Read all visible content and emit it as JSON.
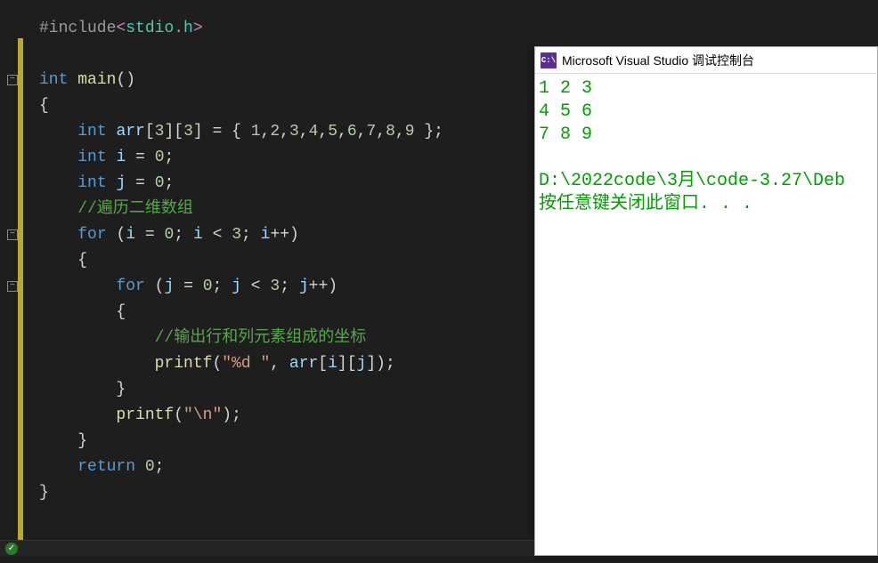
{
  "editor": {
    "lines": [
      {
        "html": "<span class='pp'>#include</span><span class='hd'>&lt;</span><span class='hn'>stdio.h</span><span class='hd'>&gt;</span>",
        "indent": 1
      },
      {
        "html": "",
        "indent": 0
      },
      {
        "html": "<span class='kw'>int</span> <span class='fn'>main</span><span class='pu'>()</span>",
        "indent": 0,
        "fold": true
      },
      {
        "html": "<span class='pu'>{</span>",
        "indent": 0
      },
      {
        "html": "    <span class='kw'>int</span> <span class='id'>arr</span><span class='pu'>[</span><span class='nm'>3</span><span class='pu'>][</span><span class='nm'>3</span><span class='pu'>] = { </span><span class='nm'>1</span><span class='pu'>,</span><span class='nm'>2</span><span class='pu'>,</span><span class='nm'>3</span><span class='pu'>,</span><span class='nm'>4</span><span class='pu'>,</span><span class='nm'>5</span><span class='pu'>,</span><span class='nm'>6</span><span class='pu'>,</span><span class='nm'>7</span><span class='pu'>,</span><span class='nm'>8</span><span class='pu'>,</span><span class='nm'>9</span><span class='pu'> };</span>",
        "indent": 0
      },
      {
        "html": "    <span class='kw'>int</span> <span class='id'>i</span> <span class='pu'>=</span> <span class='nm'>0</span><span class='pu'>;</span>",
        "indent": 0
      },
      {
        "html": "    <span class='kw'>int</span> <span class='id'>j</span> <span class='pu'>=</span> <span class='nm'>0</span><span class='pu'>;</span>",
        "indent": 0
      },
      {
        "html": "    <span class='cm'>//遍历二维数组</span>",
        "indent": 0
      },
      {
        "html": "    <span class='kw'>for</span> <span class='pu'>(</span><span class='id'>i</span> <span class='pu'>=</span> <span class='nm'>0</span><span class='pu'>;</span> <span class='id'>i</span> <span class='pu'>&lt;</span> <span class='nm'>3</span><span class='pu'>;</span> <span class='id'>i</span><span class='pu'>++)</span>",
        "indent": 0,
        "fold": true
      },
      {
        "html": "    <span class='pu'>{</span>",
        "indent": 0
      },
      {
        "html": "        <span class='kw'>for</span> <span class='pu'>(</span><span class='id'>j</span> <span class='pu'>=</span> <span class='nm'>0</span><span class='pu'>;</span> <span class='id'>j</span> <span class='pu'>&lt;</span> <span class='nm'>3</span><span class='pu'>;</span> <span class='id'>j</span><span class='pu'>++)</span>",
        "indent": 0,
        "fold": true
      },
      {
        "html": "        <span class='pu'>{</span>",
        "indent": 0
      },
      {
        "html": "            <span class='cm'>//输出行和列元素组成的坐标</span>",
        "indent": 0
      },
      {
        "html": "            <span class='fn'>printf</span><span class='pu'>(</span><span class='st'>\"%d \"</span><span class='pu'>,</span> <span class='id'>arr</span><span class='pu'>[</span><span class='id'>i</span><span class='pu'>][</span><span class='id'>j</span><span class='pu'>]);</span>",
        "indent": 0
      },
      {
        "html": "        <span class='pu'>}</span>",
        "indent": 0
      },
      {
        "html": "        <span class='fn'>printf</span><span class='pu'>(</span><span class='st'>\"\\n\"</span><span class='pu'>);</span>",
        "indent": 0,
        "highlight": true
      },
      {
        "html": "    <span class='pu'>}</span>",
        "indent": 0
      },
      {
        "html": "    <span class='kw'>return</span> <span class='nm'>0</span><span class='pu'>;</span>",
        "indent": 0
      },
      {
        "html": "<span class='pu'>}</span>",
        "indent": 0
      }
    ],
    "fold_glyph": "−"
  },
  "console": {
    "title": "Microsoft Visual Studio 调试控制台",
    "icon_text": "C:\\",
    "output_rows": [
      "1 2 3",
      "4 5 6",
      "7 8 9"
    ],
    "path_line": "D:\\2022code\\3月\\code-3.27\\Deb",
    "prompt_line": "按任意键关闭此窗口. . ."
  },
  "status": {
    "text": ""
  }
}
